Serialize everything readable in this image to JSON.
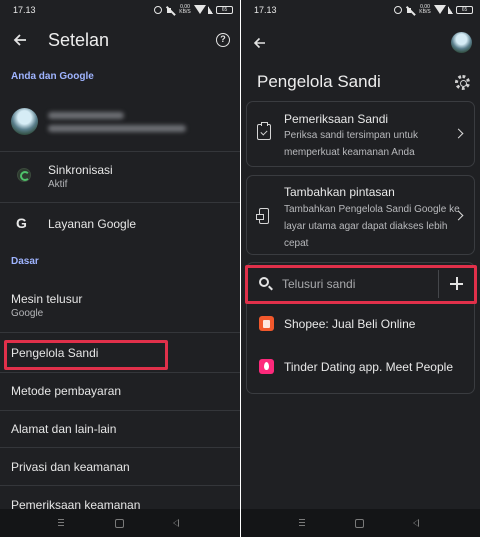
{
  "left": {
    "status": {
      "time": "17.13",
      "speed": "0,00\nKB/S",
      "battery": "65"
    },
    "header": {
      "title": "Setelan"
    },
    "sections": {
      "account": "Anda dan Google",
      "basics": "Dasar"
    },
    "sync": {
      "title": "Sinkronisasi",
      "subtitle": "Aktif"
    },
    "google_services": {
      "title": "Layanan Google"
    },
    "search_engine": {
      "title": "Mesin telusur",
      "subtitle": "Google"
    },
    "menu": [
      "Pengelola Sandi",
      "Metode pembayaran",
      "Alamat dan lain-lain",
      "Privasi dan keamanan",
      "Pemeriksaan keamanan"
    ]
  },
  "right": {
    "status": {
      "time": "17.13",
      "speed": "0,00\nKB/S",
      "battery": "65"
    },
    "header": {
      "title": "Pengelola Sandi"
    },
    "cards": [
      {
        "title": "Pemeriksaan Sandi",
        "description": "Periksa sandi tersimpan untuk memperkuat keamanan Anda"
      },
      {
        "title": "Tambahkan pintasan",
        "description": "Tambahkan Pengelola Sandi Google ke layar utama agar dapat diakses lebih cepat"
      }
    ],
    "search": {
      "placeholder": "Telusuri sandi"
    },
    "passwords": [
      {
        "name": "Shopee: Jual Beli Online",
        "icon": "shopee-icon",
        "color": "#f1582c"
      },
      {
        "name": "Tinder Dating app. Meet People",
        "icon": "tinder-icon",
        "color": "#fd297b"
      }
    ]
  },
  "colors": {
    "background": "#1f2023",
    "section_label": "#9fb4ff",
    "highlight": "#e0304a"
  }
}
